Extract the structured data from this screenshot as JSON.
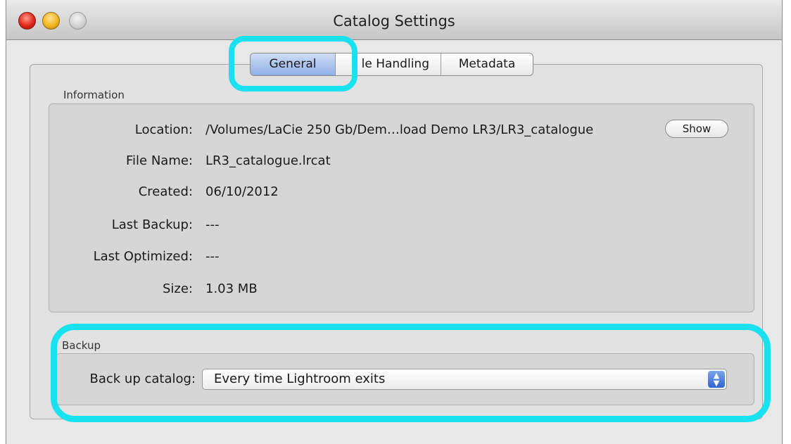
{
  "window": {
    "title": "Catalog Settings"
  },
  "tabs": [
    {
      "label": "General"
    },
    {
      "label": "le Handling"
    },
    {
      "label": "Metadata"
    }
  ],
  "information": {
    "section_label": "Information",
    "rows": [
      {
        "label": "Location:",
        "value": "/Volumes/LaCie 250 Gb/Dem…load Demo LR3/LR3_catalogue"
      },
      {
        "label": "File Name:",
        "value": "LR3_catalogue.lrcat"
      },
      {
        "label": "Created:",
        "value": "06/10/2012"
      },
      {
        "label": "Last Backup:",
        "value": "---"
      },
      {
        "label": "Last Optimized:",
        "value": "---"
      },
      {
        "label": "Size:",
        "value": "1.03 MB"
      }
    ],
    "show_button": "Show"
  },
  "backup": {
    "section_label": "Backup",
    "field_label": "Back up catalog:",
    "selected_value": "Every time Lightroom exits"
  },
  "colors": {
    "highlight": "#19e2f0",
    "active_tab": "#8fb0e6"
  }
}
